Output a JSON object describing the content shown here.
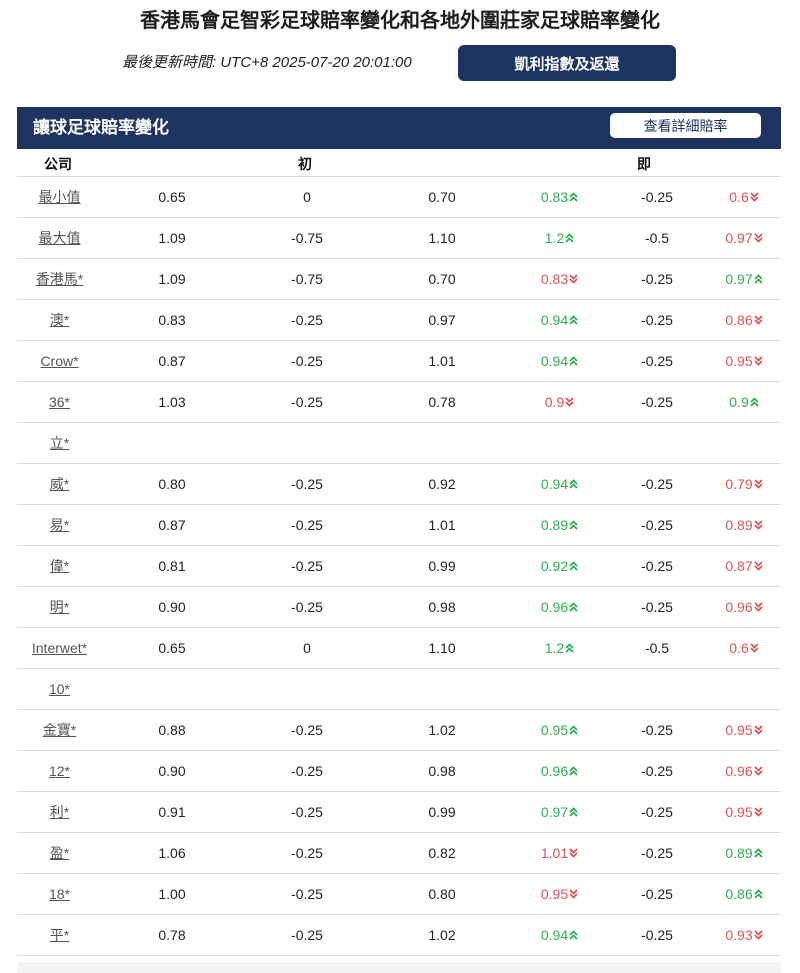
{
  "page": {
    "title": "香港馬會足智彩足球賠率變化和各地外圍莊家足球賠率變化",
    "update_label": "最後更新時間: UTC+8 2025-07-20 20:01:00",
    "kelly_button": "凱利指數及返還"
  },
  "panel": {
    "title": "讓球足球賠率變化",
    "detail_button": "查看詳細賠率",
    "columns": {
      "company": "公司",
      "initial": "初",
      "live": "即"
    }
  },
  "colors": {
    "header_bg": "#1d3461",
    "up": "#2eaf4e",
    "down": "#e05454"
  },
  "rows": [
    {
      "company": "最小值",
      "i_home": "0.65",
      "i_line": "0",
      "i_away": "0.70",
      "l_home": "0.83",
      "l_home_dir": "up",
      "l_line": "-0.25",
      "l_away": "0.6",
      "l_away_dir": "down"
    },
    {
      "company": "最大值",
      "i_home": "1.09",
      "i_line": "-0.75",
      "i_away": "1.10",
      "l_home": "1.2",
      "l_home_dir": "up",
      "l_line": "-0.5",
      "l_away": "0.97",
      "l_away_dir": "down"
    },
    {
      "company": "香港馬*",
      "i_home": "1.09",
      "i_line": "-0.75",
      "i_away": "0.70",
      "l_home": "0.83",
      "l_home_dir": "down",
      "l_line": "-0.25",
      "l_away": "0.97",
      "l_away_dir": "up"
    },
    {
      "company": "澳*",
      "i_home": "0.83",
      "i_line": "-0.25",
      "i_away": "0.97",
      "l_home": "0.94",
      "l_home_dir": "up",
      "l_line": "-0.25",
      "l_away": "0.86",
      "l_away_dir": "down"
    },
    {
      "company": "Crow*",
      "i_home": "0.87",
      "i_line": "-0.25",
      "i_away": "1.01",
      "l_home": "0.94",
      "l_home_dir": "up",
      "l_line": "-0.25",
      "l_away": "0.95",
      "l_away_dir": "down"
    },
    {
      "company": "36*",
      "i_home": "1.03",
      "i_line": "-0.25",
      "i_away": "0.78",
      "l_home": "0.9",
      "l_home_dir": "down",
      "l_line": "-0.25",
      "l_away": "0.9",
      "l_away_dir": "up"
    },
    {
      "company": "立*",
      "i_home": "",
      "i_line": "",
      "i_away": "",
      "l_home": "",
      "l_home_dir": "",
      "l_line": "",
      "l_away": "",
      "l_away_dir": ""
    },
    {
      "company": "威*",
      "i_home": "0.80",
      "i_line": "-0.25",
      "i_away": "0.92",
      "l_home": "0.94",
      "l_home_dir": "up",
      "l_line": "-0.25",
      "l_away": "0.79",
      "l_away_dir": "down"
    },
    {
      "company": "易*",
      "i_home": "0.87",
      "i_line": "-0.25",
      "i_away": "1.01",
      "l_home": "0.89",
      "l_home_dir": "up",
      "l_line": "-0.25",
      "l_away": "0.89",
      "l_away_dir": "down"
    },
    {
      "company": "偉*",
      "i_home": "0.81",
      "i_line": "-0.25",
      "i_away": "0.99",
      "l_home": "0.92",
      "l_home_dir": "up",
      "l_line": "-0.25",
      "l_away": "0.87",
      "l_away_dir": "down"
    },
    {
      "company": "明*",
      "i_home": "0.90",
      "i_line": "-0.25",
      "i_away": "0.98",
      "l_home": "0.96",
      "l_home_dir": "up",
      "l_line": "-0.25",
      "l_away": "0.96",
      "l_away_dir": "down"
    },
    {
      "company": "Interwet*",
      "i_home": "0.65",
      "i_line": "0",
      "i_away": "1.10",
      "l_home": "1.2",
      "l_home_dir": "up",
      "l_line": "-0.5",
      "l_away": "0.6",
      "l_away_dir": "down"
    },
    {
      "company": "10*",
      "i_home": "",
      "i_line": "",
      "i_away": "",
      "l_home": "",
      "l_home_dir": "",
      "l_line": "",
      "l_away": "",
      "l_away_dir": ""
    },
    {
      "company": "金寶*",
      "i_home": "0.88",
      "i_line": "-0.25",
      "i_away": "1.02",
      "l_home": "0.95",
      "l_home_dir": "up",
      "l_line": "-0.25",
      "l_away": "0.95",
      "l_away_dir": "down"
    },
    {
      "company": "12*",
      "i_home": "0.90",
      "i_line": "-0.25",
      "i_away": "0.98",
      "l_home": "0.96",
      "l_home_dir": "up",
      "l_line": "-0.25",
      "l_away": "0.96",
      "l_away_dir": "down"
    },
    {
      "company": "利*",
      "i_home": "0.91",
      "i_line": "-0.25",
      "i_away": "0.99",
      "l_home": "0.97",
      "l_home_dir": "up",
      "l_line": "-0.25",
      "l_away": "0.95",
      "l_away_dir": "down"
    },
    {
      "company": "盈*",
      "i_home": "1.06",
      "i_line": "-0.25",
      "i_away": "0.82",
      "l_home": "1.01",
      "l_home_dir": "down",
      "l_line": "-0.25",
      "l_away": "0.89",
      "l_away_dir": "up"
    },
    {
      "company": "18*",
      "i_home": "1.00",
      "i_line": "-0.25",
      "i_away": "0.80",
      "l_home": "0.95",
      "l_home_dir": "down",
      "l_line": "-0.25",
      "l_away": "0.86",
      "l_away_dir": "up"
    },
    {
      "company": "平*",
      "i_home": "0.78",
      "i_line": "-0.25",
      "i_away": "1.02",
      "l_home": "0.94",
      "l_home_dir": "up",
      "l_line": "-0.25",
      "l_away": "0.93",
      "l_away_dir": "down"
    }
  ]
}
